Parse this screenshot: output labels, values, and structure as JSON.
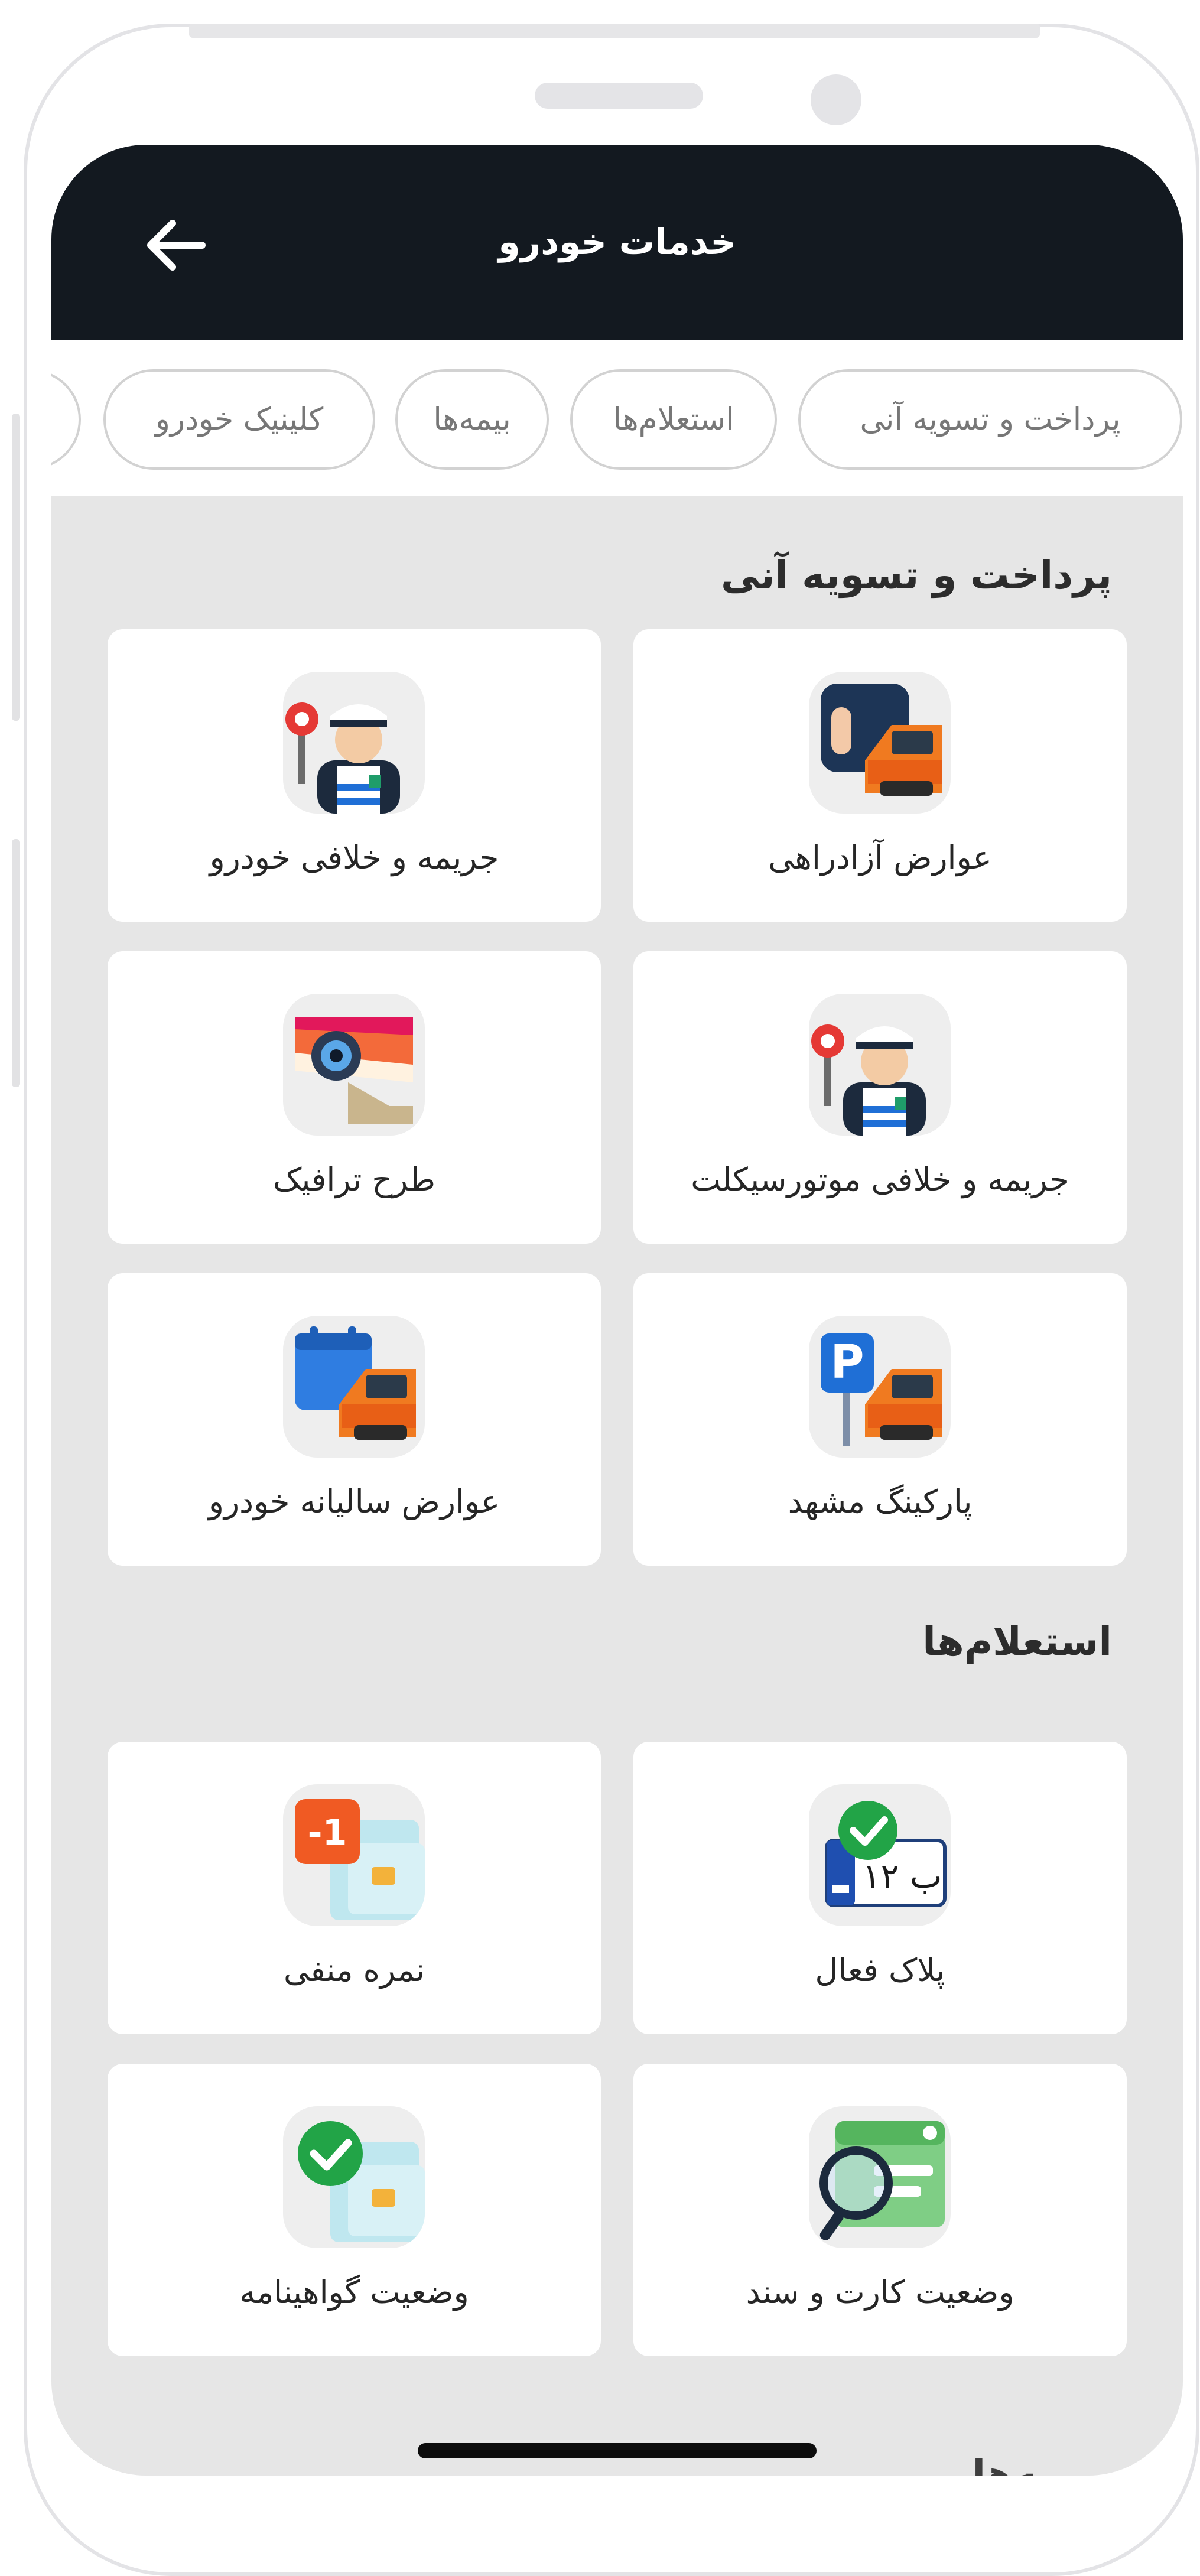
{
  "header": {
    "title": "خدمات خودرو",
    "back_icon": "arrow-left-icon"
  },
  "tabs": [
    {
      "label": "پرداخت و تسویه آنی"
    },
    {
      "label": "استعلام‌ها"
    },
    {
      "label": "بیمه‌ها"
    },
    {
      "label": "کلینیک خودرو"
    }
  ],
  "sections": [
    {
      "title": "پرداخت و تسویه آنی",
      "items": [
        {
          "label": "عوارض آزادراهی",
          "icon": "car-toll-icon"
        },
        {
          "label": "جریمه و خلافی خودرو",
          "icon": "traffic-police-icon"
        },
        {
          "label": "جریمه و خلافی موتورسیکلت",
          "icon": "traffic-police-icon"
        },
        {
          "label": "طرح ترافیک",
          "icon": "traffic-camera-icon"
        },
        {
          "label": "پارکینگ مشهد",
          "icon": "parking-icon"
        },
        {
          "label": "عوارض سالیانه خودرو",
          "icon": "calendar-car-icon"
        }
      ]
    },
    {
      "title": "استعلام‌ها",
      "items": [
        {
          "label": "پلاک فعال",
          "icon": "license-plate-check-icon",
          "plate_text": "ب ۱۲"
        },
        {
          "label": "نمره منفی",
          "icon": "negative-point-card-icon",
          "badge_text": "-1"
        },
        {
          "label": "وضعیت کارت و سند",
          "icon": "card-search-icon"
        },
        {
          "label": "وضعیت گواهینامه",
          "icon": "license-check-icon"
        }
      ]
    },
    {
      "title": "بیمه‌ها"
    }
  ],
  "colors": {
    "header_bg": "#131920",
    "content_bg": "#e6e6e6",
    "accent_orange": "#f07a20",
    "accent_green": "#22a447",
    "accent_blue": "#1f6fd6"
  }
}
